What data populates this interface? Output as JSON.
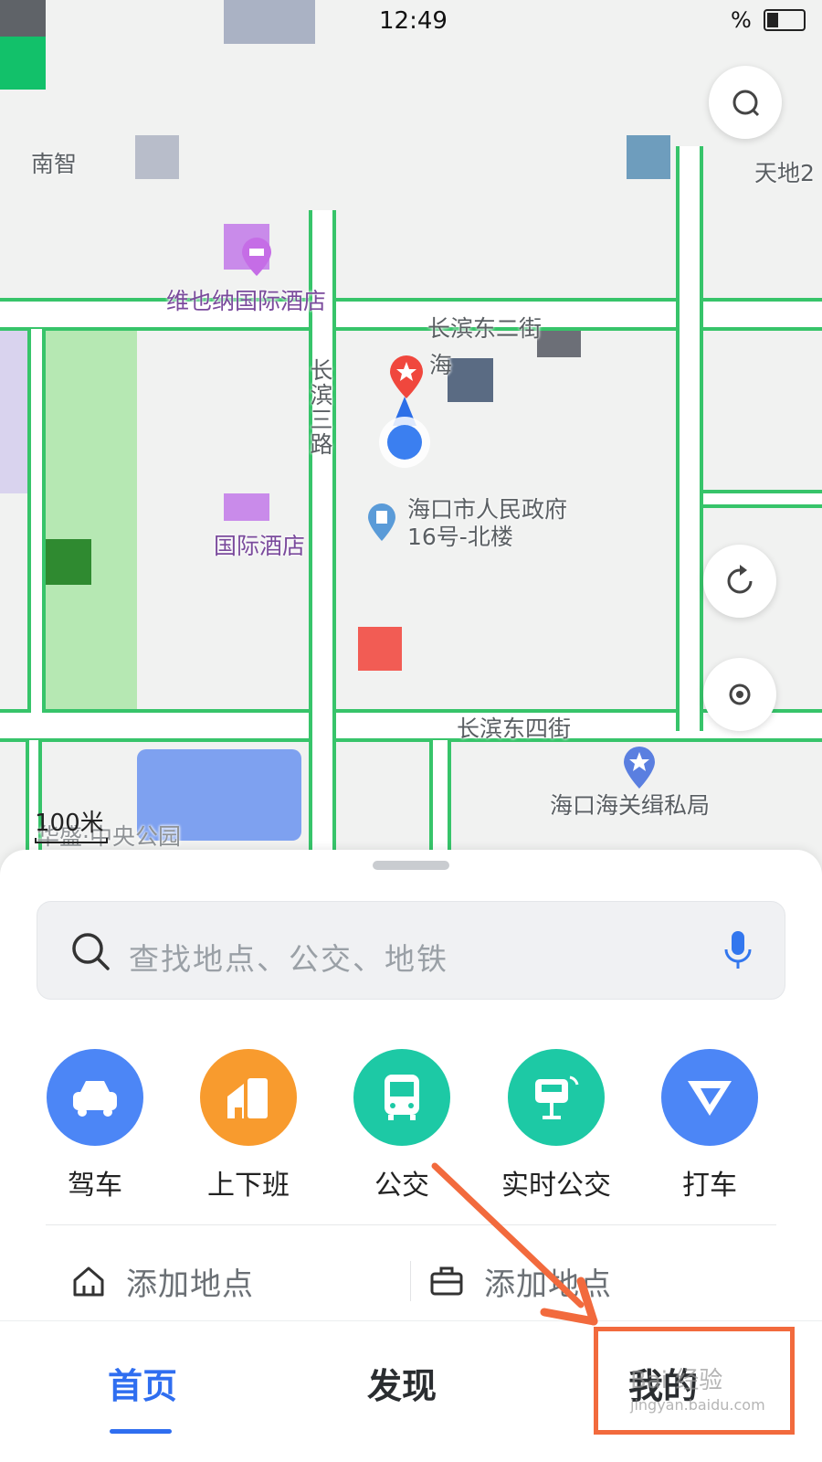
{
  "status": {
    "time": "12:49",
    "battery": "%"
  },
  "map": {
    "labels": {
      "nanzhi": "南智",
      "tiandi": "天地2",
      "hotel1": "维也纳国际酒店",
      "hotel2": "国际酒店",
      "road_changbin_2": "长滨东二街",
      "road_changbin_3": "长滨三路",
      "road_changbin_4": "长滨东四街",
      "gov": "海口市人民政府16号-北楼",
      "customs": "海口海关缉私局",
      "park": "华盛·中央公园",
      "hai": "海"
    },
    "scale": "100米"
  },
  "search": {
    "placeholder": "查找地点、公交、地铁"
  },
  "shortcuts": [
    {
      "label": "驾车",
      "color": "#4c86f6",
      "icon": "car-icon"
    },
    {
      "label": "上下班",
      "color": "#f89b2e",
      "icon": "commute-icon"
    },
    {
      "label": "公交",
      "color": "#1dc9a5",
      "icon": "bus-icon"
    },
    {
      "label": "实时公交",
      "color": "#1dc9a5",
      "icon": "realtime-bus-icon"
    },
    {
      "label": "打车",
      "color": "#4c86f6",
      "icon": "taxi-icon"
    }
  ],
  "favorites": [
    {
      "label": "添加地点",
      "icon": "home-icon"
    },
    {
      "label": "添加地点",
      "icon": "briefcase-icon"
    }
  ],
  "tabs": [
    {
      "label": "首页",
      "active": true
    },
    {
      "label": "发现",
      "active": false
    },
    {
      "label": "我的",
      "active": false
    }
  ],
  "watermark": {
    "text": "Bai 经验",
    "url": "jingyan.baidu.com"
  },
  "colors": {
    "accent": "#2f6ef0",
    "road": "#37c46a",
    "annotation": "#f26a3d"
  }
}
